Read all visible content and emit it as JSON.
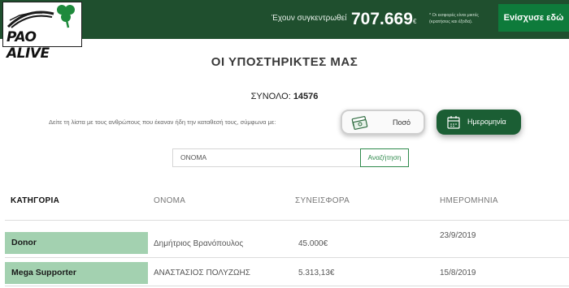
{
  "header": {
    "logo_text": "PAO ALIVE",
    "raised_label": "Έχουν συγκεντρωθεί",
    "raised_amount": "707.669",
    "currency": "€",
    "note": "* Οι εισφορές είναι μικτές (κρατήσεις και έξοδα).",
    "support_button": "Ενίσχυσε εδώ",
    "brand_color": "#1f4f2e",
    "accent_color": "#0e7b3b"
  },
  "page": {
    "title": "ΟΙ ΥΠΟΣΤΗΡΙΚΤΕΣ ΜΑΣ",
    "total_label": "ΣΥΝΟΛΟ:",
    "total_value": "14576",
    "sort_text": "Δείτε τη λίστα με τους ανθρώπους που έκαναν ήδη την καταθεσή τους, σύμφωνα με:",
    "sort_amount_label": "Ποσό",
    "sort_date_label": "Ημερομηνία",
    "search_placeholder": "ΟΝΟΜΑ",
    "search_button": "Αναζήτηση"
  },
  "table": {
    "headers": [
      "ΚΑΤΗΓΟΡΙΑ",
      "ΟΝΟΜΑ",
      "ΣΥΝΕΙΣΦΟΡΑ",
      "ΗΜΕΡΟΜΗΝΙΑ"
    ],
    "rows": [
      {
        "category": "Donor",
        "name": "Δημήτριος Βρανόπουλος",
        "amount": "45.000€",
        "date": "23/9/2019"
      },
      {
        "category": "Mega Supporter",
        "name": "ΑΝΑΣΤΑΣΙΟΣ ΠΟΛΥΖΩΗΣ",
        "amount": "5.313,13€",
        "date": "15/8/2019"
      }
    ]
  }
}
